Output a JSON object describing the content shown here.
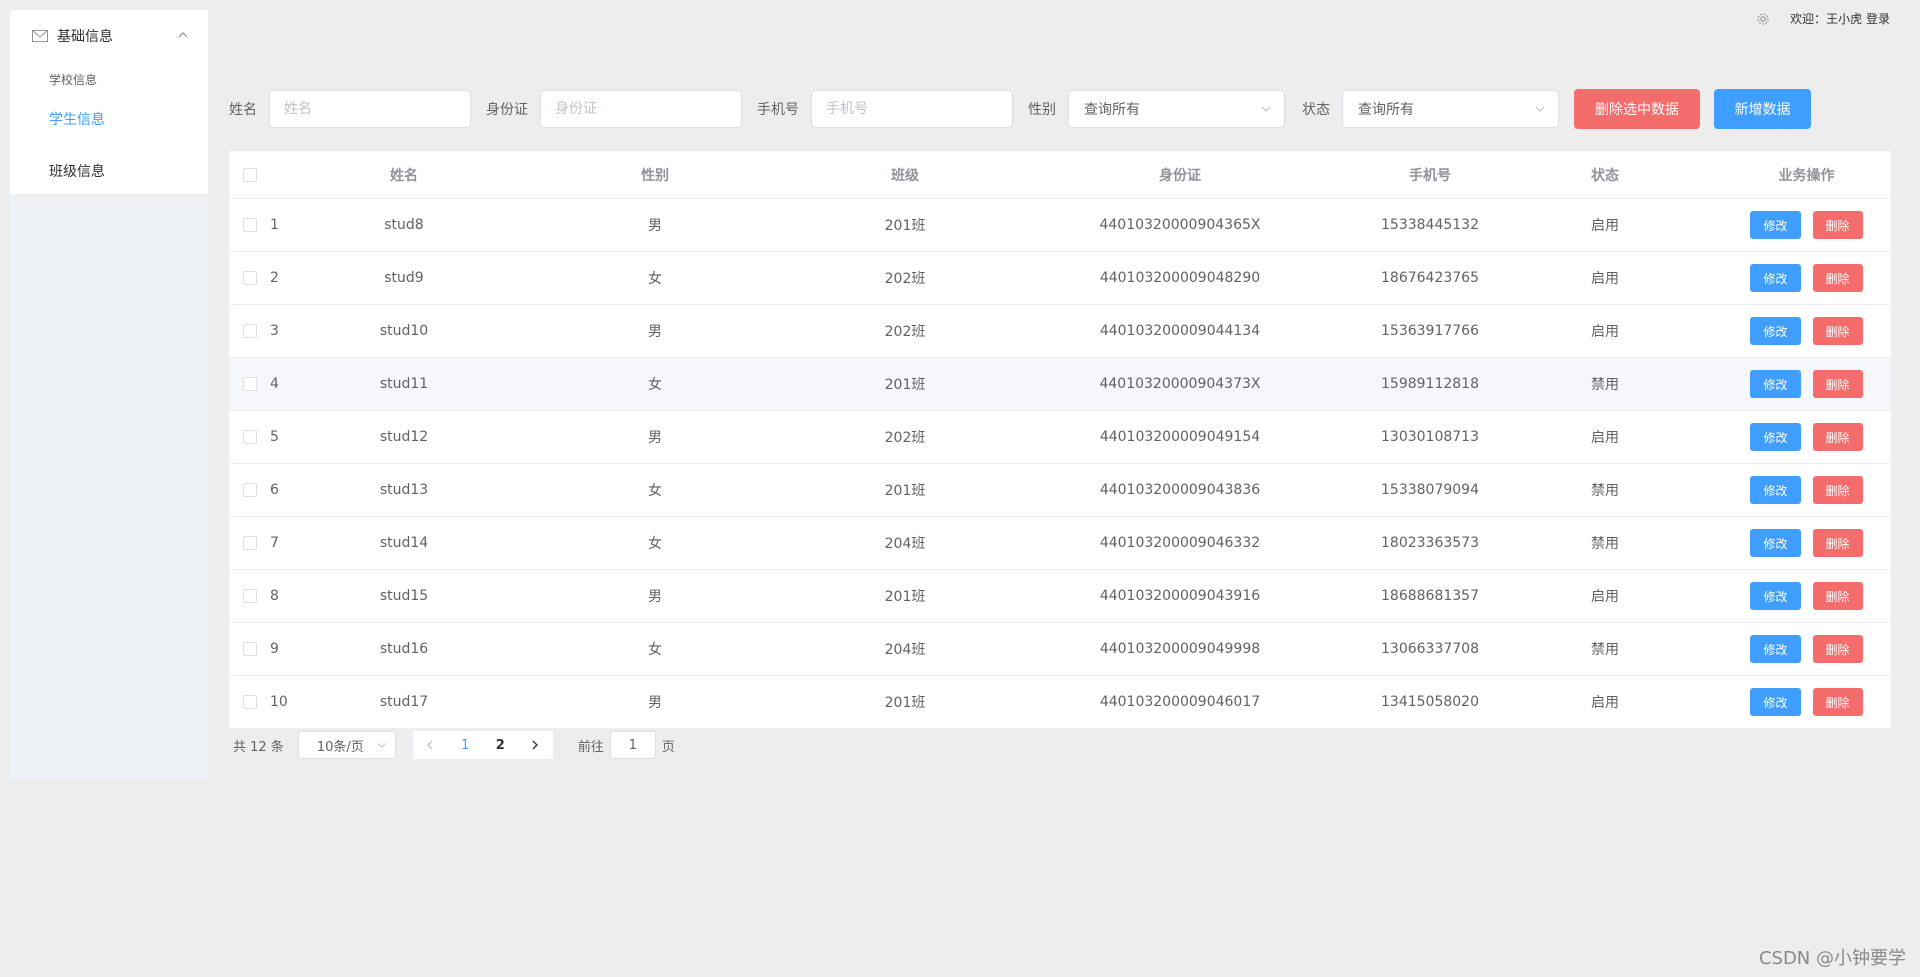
{
  "sidebar": {
    "group_title": "基础信息",
    "items": [
      {
        "label": "学校信息"
      },
      {
        "label": "学生信息"
      },
      {
        "label": "班级信息"
      }
    ]
  },
  "header": {
    "welcome": "欢迎：王小虎 登录"
  },
  "search": {
    "name_label": "姓名",
    "name_placeholder": "姓名",
    "id_label": "身份证",
    "id_placeholder": "身份证",
    "phone_label": "手机号",
    "phone_placeholder": "手机号",
    "gender_label": "性别",
    "gender_value": "查询所有",
    "status_label": "状态",
    "status_value": "查询所有",
    "delete_selected": "删除选中数据",
    "add_data": "新增数据"
  },
  "table": {
    "headers": [
      "姓名",
      "性别",
      "班级",
      "身份证",
      "手机号",
      "状态",
      "业务操作"
    ],
    "edit_label": "修改",
    "delete_label": "删除",
    "rows": [
      {
        "idx": "1",
        "name": "stud8",
        "gender": "男",
        "cls": "201班",
        "id": "44010320000904365X",
        "phone": "15338445132",
        "status": "启用"
      },
      {
        "idx": "2",
        "name": "stud9",
        "gender": "女",
        "cls": "202班",
        "id": "440103200009048290",
        "phone": "18676423765",
        "status": "启用"
      },
      {
        "idx": "3",
        "name": "stud10",
        "gender": "男",
        "cls": "202班",
        "id": "440103200009044134",
        "phone": "15363917766",
        "status": "启用"
      },
      {
        "idx": "4",
        "name": "stud11",
        "gender": "女",
        "cls": "201班",
        "id": "44010320000904373X",
        "phone": "15989112818",
        "status": "禁用"
      },
      {
        "idx": "5",
        "name": "stud12",
        "gender": "男",
        "cls": "202班",
        "id": "440103200009049154",
        "phone": "13030108713",
        "status": "启用"
      },
      {
        "idx": "6",
        "name": "stud13",
        "gender": "女",
        "cls": "201班",
        "id": "440103200009043836",
        "phone": "15338079094",
        "status": "禁用"
      },
      {
        "idx": "7",
        "name": "stud14",
        "gender": "女",
        "cls": "204班",
        "id": "440103200009046332",
        "phone": "18023363573",
        "status": "禁用"
      },
      {
        "idx": "8",
        "name": "stud15",
        "gender": "男",
        "cls": "201班",
        "id": "440103200009043916",
        "phone": "18688681357",
        "status": "启用"
      },
      {
        "idx": "9",
        "name": "stud16",
        "gender": "女",
        "cls": "204班",
        "id": "440103200009049998",
        "phone": "13066337708",
        "status": "禁用"
      },
      {
        "idx": "10",
        "name": "stud17",
        "gender": "男",
        "cls": "201班",
        "id": "440103200009046017",
        "phone": "13415058020",
        "status": "启用"
      }
    ]
  },
  "pagination": {
    "total": "共 12 条",
    "page_size": "10条/页",
    "pages": [
      "1",
      "2"
    ],
    "goto_label": "前往",
    "goto_value": "1",
    "page_unit": "页"
  },
  "watermark": "CSDN @小钟要学",
  "colors": {
    "primary": "#409eff",
    "danger": "#f56c6c"
  },
  "icons": [
    "mail-icon",
    "chevron-up-icon",
    "gear-icon",
    "chevron-down-icon",
    "chevron-left-icon",
    "chevron-right-icon"
  ]
}
